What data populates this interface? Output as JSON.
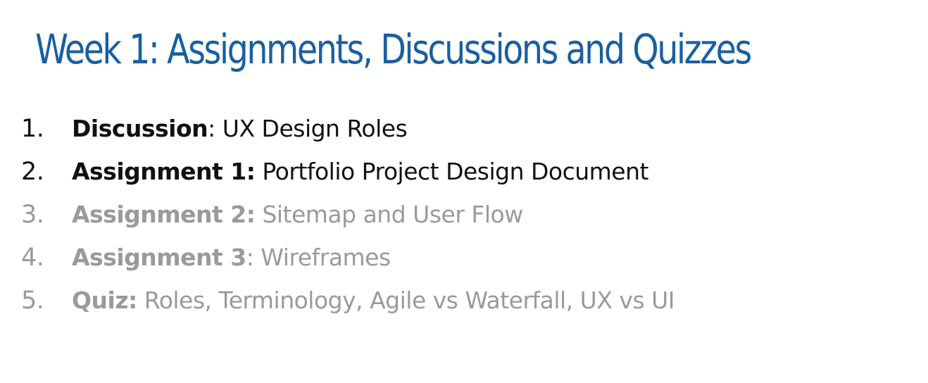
{
  "slide": {
    "title": "Week 1: Assignments, Discussions and Quizzes",
    "items": [
      {
        "number": "1.",
        "label": "Discussion",
        "separator": ":",
        "text": " UX Design Roles",
        "state": "active"
      },
      {
        "number": "2.",
        "label": "Assignment 1:",
        "separator": "",
        "text": " Portfolio Project Design Document",
        "state": "active"
      },
      {
        "number": "3.",
        "label": "Assignment 2:",
        "separator": "",
        "text": " Sitemap and User Flow",
        "state": "dimmed"
      },
      {
        "number": "4.",
        "label": "Assignment 3",
        "separator": ":",
        "text": " Wireframes",
        "state": "dimmed"
      },
      {
        "number": "5.",
        "label": "Quiz:",
        "separator": "",
        "text": " Roles, Terminology, Agile vs Waterfall, UX vs UI",
        "state": "dimmed"
      }
    ]
  },
  "colors": {
    "title": "#1a5fa0",
    "active_text": "#111111",
    "dimmed_text": "#9a9a9a"
  }
}
